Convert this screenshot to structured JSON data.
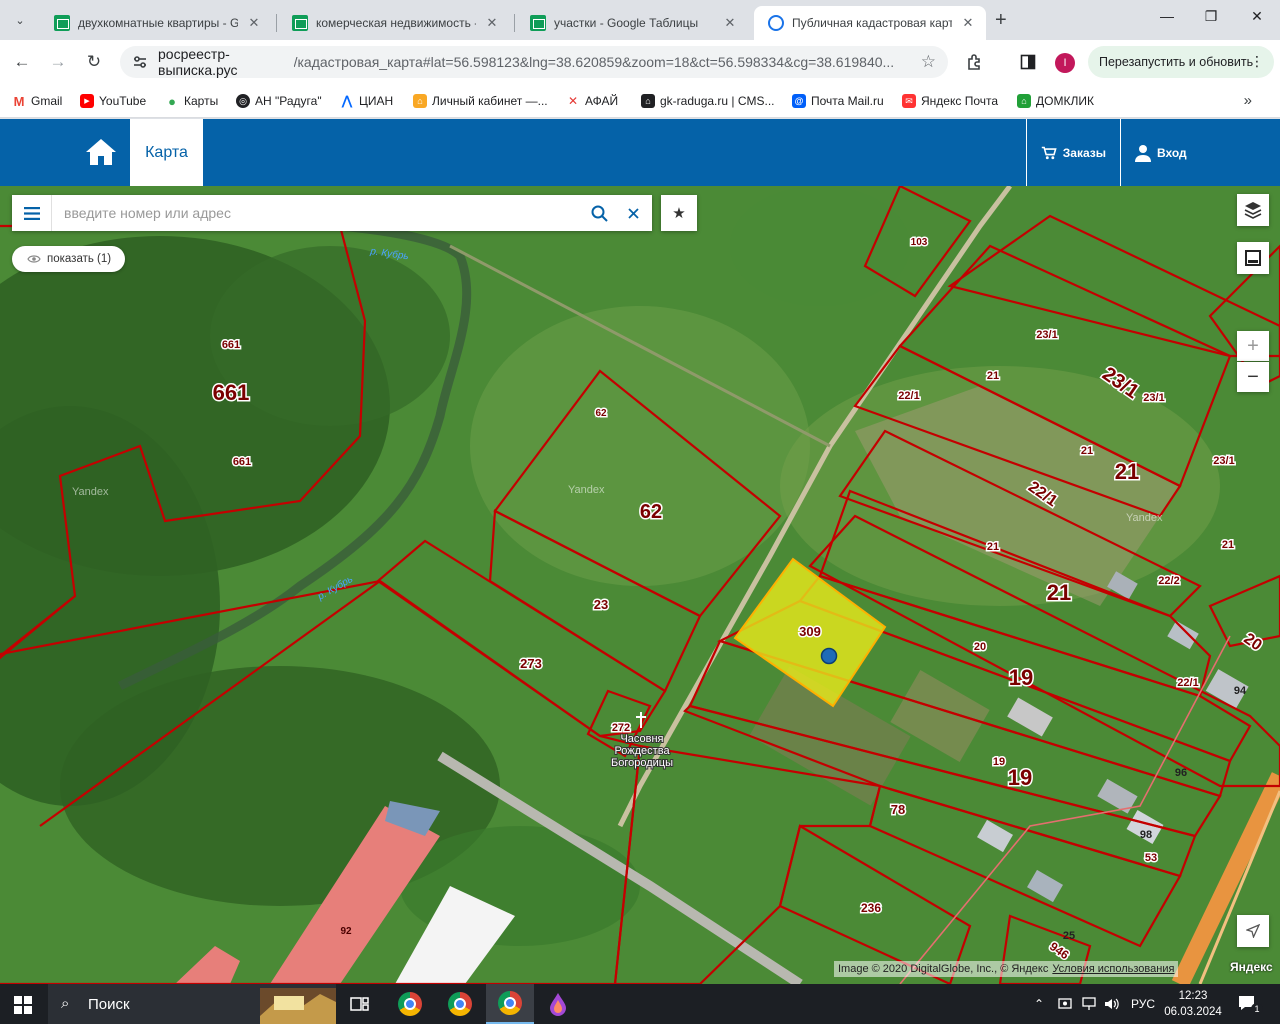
{
  "browser": {
    "tabs": [
      {
        "title": "двухкомнатные квартиры - Go",
        "active": false
      },
      {
        "title": "комерческая недвижимость -",
        "active": false
      },
      {
        "title": "участки - Google Таблицы",
        "active": false
      },
      {
        "title": "Публичная кадастровая карта",
        "active": true
      }
    ],
    "url_host": "росреестр-выписка.рус",
    "url_path": "/кадастровая_карта#lat=56.598123&lng=38.620859&zoom=18&ct=56.598334&cg=38.619840...",
    "profile_initial": "I",
    "relaunch_label": "Перезапустить и обновить",
    "bookmarks": [
      {
        "label": "Gmail",
        "color": "#ea4335",
        "icon": "gmail-icon"
      },
      {
        "label": "YouTube",
        "color": "#ff0000",
        "icon": "youtube-icon"
      },
      {
        "label": "Карты",
        "color": "#34a853",
        "icon": "maps-pin-icon"
      },
      {
        "label": "АН \"Радуга\"",
        "color": "#202124",
        "icon": "globe-icon"
      },
      {
        "label": "ЦИАН",
        "color": "#0468ff",
        "icon": "cian-icon"
      },
      {
        "label": "Личный кабинет —...",
        "color": "#f9a825",
        "icon": "house-icon"
      },
      {
        "label": "АФАЙ",
        "color": "#e53935",
        "icon": "afai-icon"
      },
      {
        "label": "gk-raduga.ru | CMS...",
        "color": "#202124",
        "icon": "cms-icon"
      },
      {
        "label": "Почта Mail.ru",
        "color": "#005ff9",
        "icon": "mail-icon"
      },
      {
        "label": "Яндекс Почта",
        "color": "#ff3333",
        "icon": "envelope-icon"
      },
      {
        "label": "ДОМКЛИК",
        "color": "#21a038",
        "icon": "domclick-icon"
      }
    ]
  },
  "site": {
    "map_tab": "Карта",
    "orders": "Заказы",
    "login": "Вход",
    "brand_color": "#0562a8"
  },
  "map": {
    "search_placeholder": "введите номер или адрес",
    "show_label": "показать (1)",
    "attribution": "Image © 2020 DigitalGlobe, Inc., © Яндекс",
    "terms": "Условия использования",
    "logo": "Яндекс",
    "watermark": "Yandex",
    "rivers": [
      "р. Кубрь",
      "р. Кубрь"
    ],
    "church": [
      "Часовня",
      "Рождества",
      "Богородицы"
    ],
    "selected_parcel": "309",
    "parcels": [
      "103",
      "661",
      "661",
      "661",
      "62",
      "62",
      "23",
      "273",
      "272",
      "23/1",
      "23/1",
      "23/1",
      "23/1",
      "21",
      "21",
      "21",
      "21",
      "21",
      "21",
      "22/1",
      "22/1",
      "22/1",
      "22/2",
      "20",
      "20",
      "19",
      "19",
      "19",
      "53",
      "78",
      "236",
      "946",
      "92",
      "94",
      "96",
      "98",
      "25"
    ]
  },
  "taskbar": {
    "search_label": "Поиск",
    "language": "РУС",
    "time": "12:23",
    "date": "06.03.2024",
    "notifications": "1"
  }
}
